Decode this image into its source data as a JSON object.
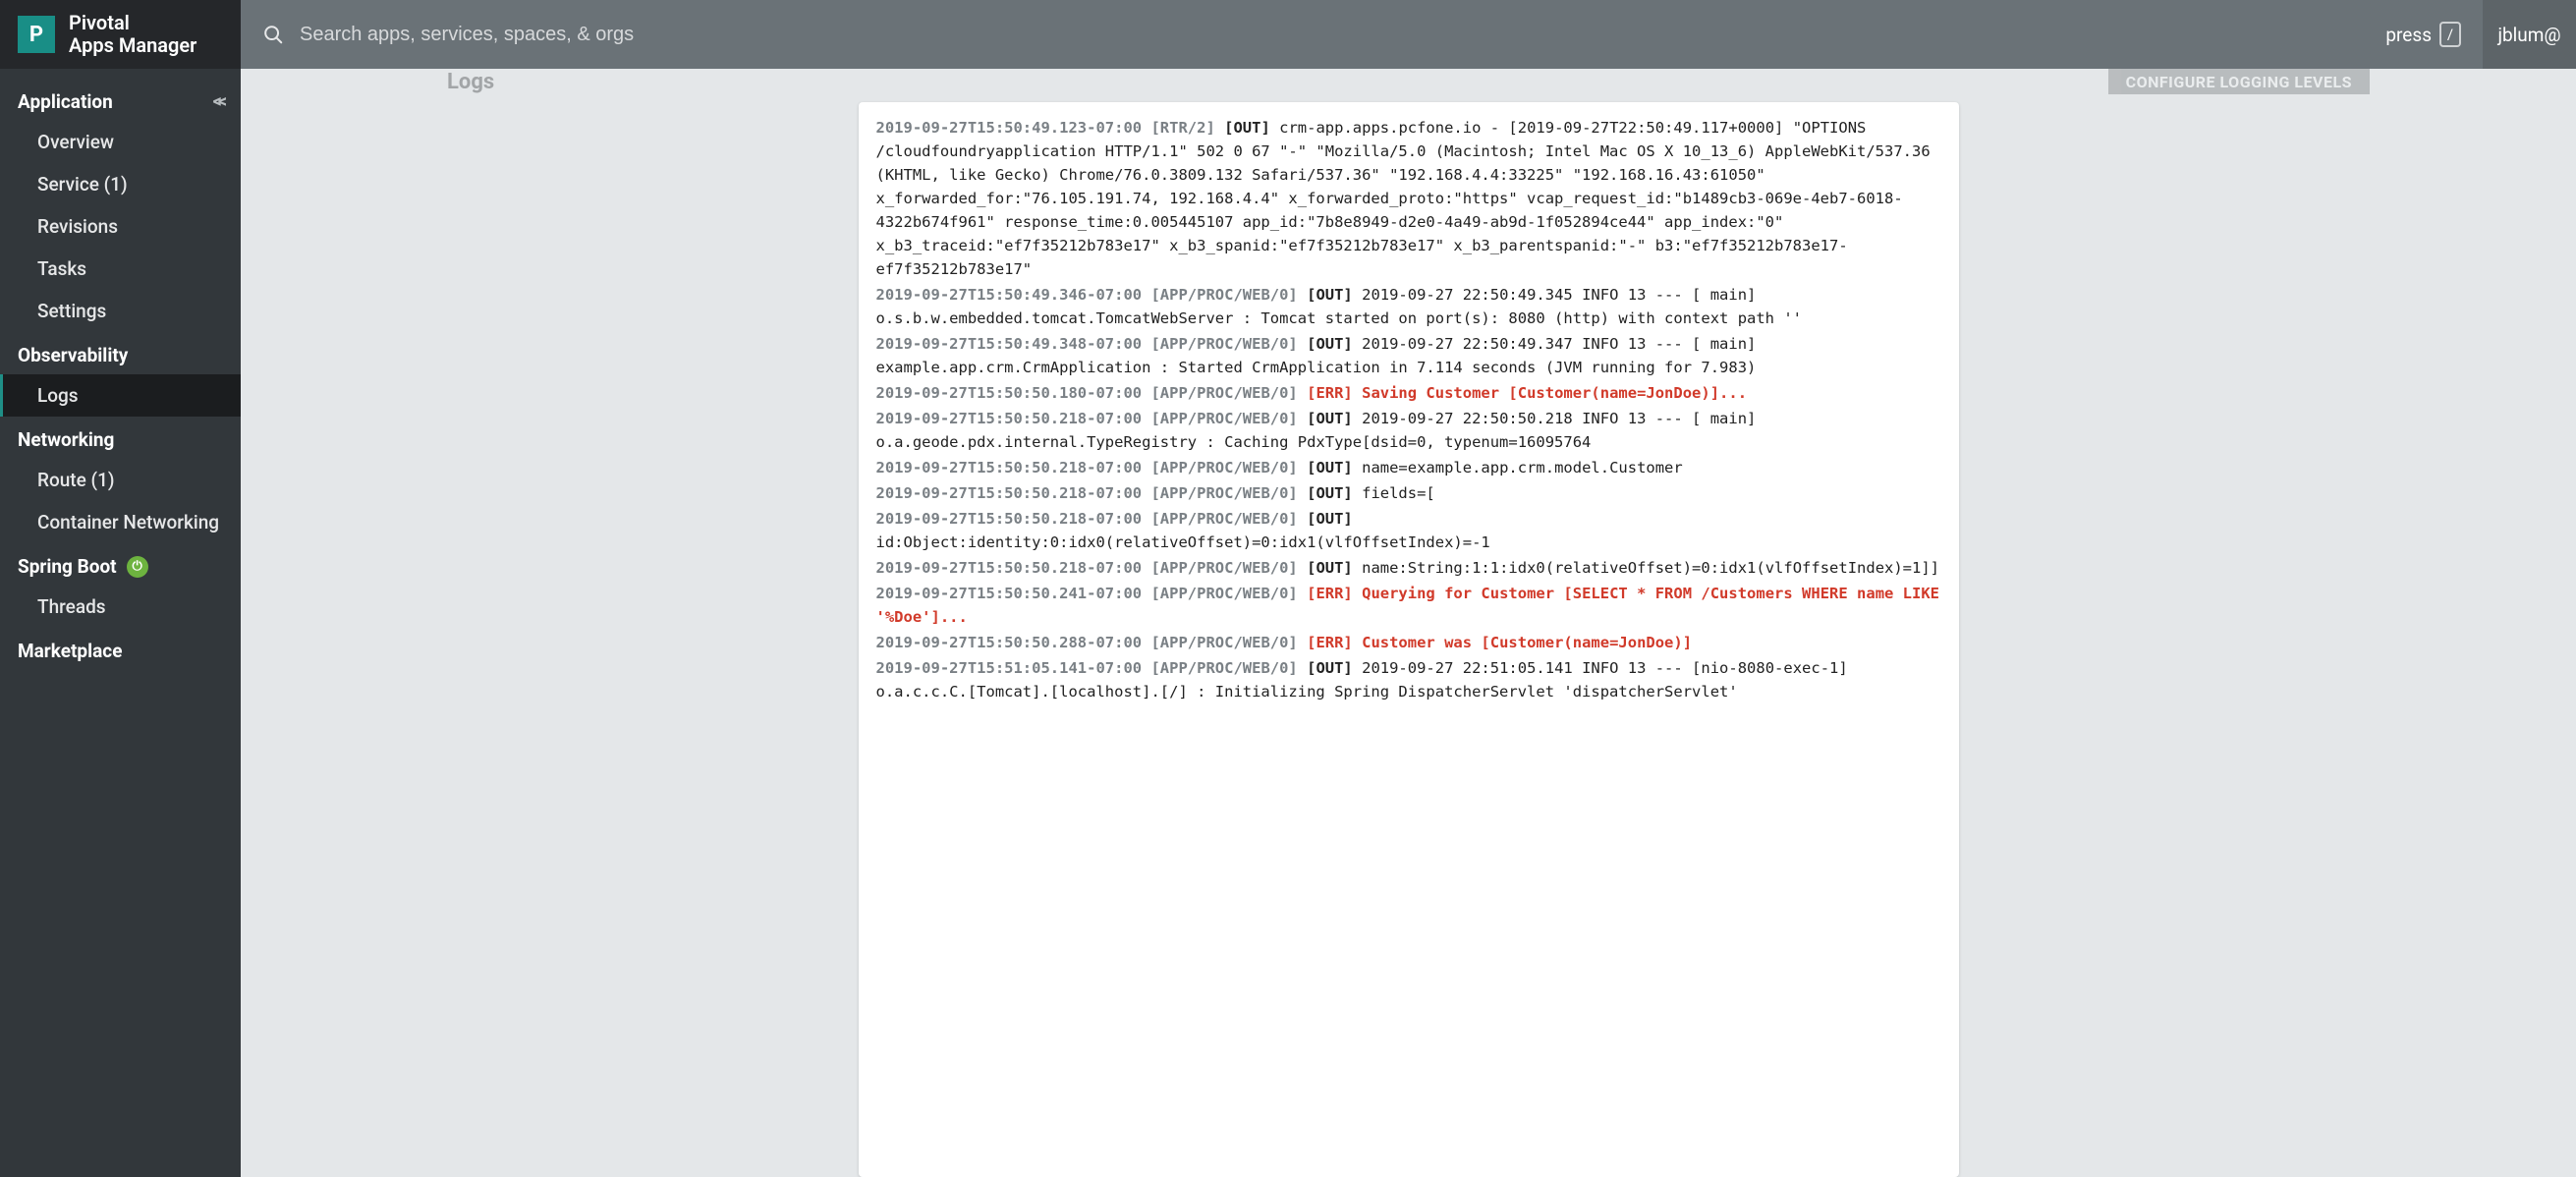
{
  "brand": {
    "logo_letter": "P",
    "line1": "Pivotal",
    "line2": "Apps Manager"
  },
  "search": {
    "placeholder": "Search apps, services, spaces, & orgs"
  },
  "press_hint": {
    "label": "press",
    "key": "/"
  },
  "user": {
    "label": "jblum@"
  },
  "sidebar": {
    "groups": [
      {
        "label": "Application",
        "collapsible": true,
        "items": [
          {
            "label": "Overview"
          },
          {
            "label": "Service (1)"
          },
          {
            "label": "Revisions"
          },
          {
            "label": "Tasks"
          },
          {
            "label": "Settings"
          }
        ]
      },
      {
        "label": "Observability",
        "items": [
          {
            "label": "Logs",
            "active": true
          }
        ]
      },
      {
        "label": "Networking",
        "items": [
          {
            "label": "Route (1)"
          },
          {
            "label": "Container Networking"
          }
        ]
      },
      {
        "label": "Spring Boot",
        "icon": "spring",
        "items": [
          {
            "label": "Threads"
          }
        ]
      },
      {
        "label": "Marketplace",
        "items": []
      }
    ]
  },
  "panel": {
    "title": "Logs",
    "configure_button": "CONFIGURE LOGGING LEVELS"
  },
  "logs": [
    {
      "ts": "2019-09-27T15:50:49.123-07:00",
      "src": "[RTR/2]",
      "tag": "OUT",
      "msg": "crm-app.apps.pcfone.io - [2019-09-27T22:50:49.117+0000] \"OPTIONS /cloudfoundryapplication HTTP/1.1\" 502 0 67 \"-\" \"Mozilla/5.0 (Macintosh; Intel Mac OS X 10_13_6) AppleWebKit/537.36 (KHTML, like Gecko) Chrome/76.0.3809.132 Safari/537.36\" \"192.168.4.4:33225\" \"192.168.16.43:61050\" x_forwarded_for:\"76.105.191.74, 192.168.4.4\" x_forwarded_proto:\"https\" vcap_request_id:\"b1489cb3-069e-4eb7-6018-4322b674f961\" response_time:0.005445107 app_id:\"7b8e8949-d2e0-4a49-ab9d-1f052894ce44\" app_index:\"0\" x_b3_traceid:\"ef7f35212b783e17\" x_b3_spanid:\"ef7f35212b783e17\" x_b3_parentspanid:\"-\" b3:\"ef7f35212b783e17-ef7f35212b783e17\""
    },
    {
      "ts": "2019-09-27T15:50:49.346-07:00",
      "src": "[APP/PROC/WEB/0]",
      "tag": "OUT",
      "msg": "2019-09-27 22:50:49.345 INFO 13 --- [ main] o.s.b.w.embedded.tomcat.TomcatWebServer : Tomcat started on port(s): 8080 (http) with context path ''"
    },
    {
      "ts": "2019-09-27T15:50:49.348-07:00",
      "src": "[APP/PROC/WEB/0]",
      "tag": "OUT",
      "msg": "2019-09-27 22:50:49.347 INFO 13 --- [ main] example.app.crm.CrmApplication : Started CrmApplication in 7.114 seconds (JVM running for 7.983)"
    },
    {
      "ts": "2019-09-27T15:50:50.180-07:00",
      "src": "[APP/PROC/WEB/0]",
      "tag": "ERR",
      "msg": "Saving Customer [Customer(name=JonDoe)]..."
    },
    {
      "ts": "2019-09-27T15:50:50.218-07:00",
      "src": "[APP/PROC/WEB/0]",
      "tag": "OUT",
      "msg": "2019-09-27 22:50:50.218 INFO 13 --- [ main] o.a.geode.pdx.internal.TypeRegistry : Caching PdxType[dsid=0, typenum=16095764"
    },
    {
      "ts": "2019-09-27T15:50:50.218-07:00",
      "src": "[APP/PROC/WEB/0]",
      "tag": "OUT",
      "msg": "name=example.app.crm.model.Customer"
    },
    {
      "ts": "2019-09-27T15:50:50.218-07:00",
      "src": "[APP/PROC/WEB/0]",
      "tag": "OUT",
      "msg": "fields=["
    },
    {
      "ts": "2019-09-27T15:50:50.218-07:00",
      "src": "[APP/PROC/WEB/0]",
      "tag": "OUT",
      "msg": "id:Object:identity:0:idx0(relativeOffset)=0:idx1(vlfOffsetIndex)=-1"
    },
    {
      "ts": "2019-09-27T15:50:50.218-07:00",
      "src": "[APP/PROC/WEB/0]",
      "tag": "OUT",
      "msg": "name:String:1:1:idx0(relativeOffset)=0:idx1(vlfOffsetIndex)=1]]"
    },
    {
      "ts": "2019-09-27T15:50:50.241-07:00",
      "src": "[APP/PROC/WEB/0]",
      "tag": "ERR",
      "msg": "Querying for Customer [SELECT * FROM /Customers WHERE name LIKE '%Doe']..."
    },
    {
      "ts": "2019-09-27T15:50:50.288-07:00",
      "src": "[APP/PROC/WEB/0]",
      "tag": "ERR",
      "msg": "Customer was [Customer(name=JonDoe)]"
    },
    {
      "ts": "2019-09-27T15:51:05.141-07:00",
      "src": "[APP/PROC/WEB/0]",
      "tag": "OUT",
      "msg": "2019-09-27 22:51:05.141 INFO 13 --- [nio-8080-exec-1] o.a.c.c.C.[Tomcat].[localhost].[/] : Initializing Spring DispatcherServlet 'dispatcherServlet'"
    }
  ]
}
